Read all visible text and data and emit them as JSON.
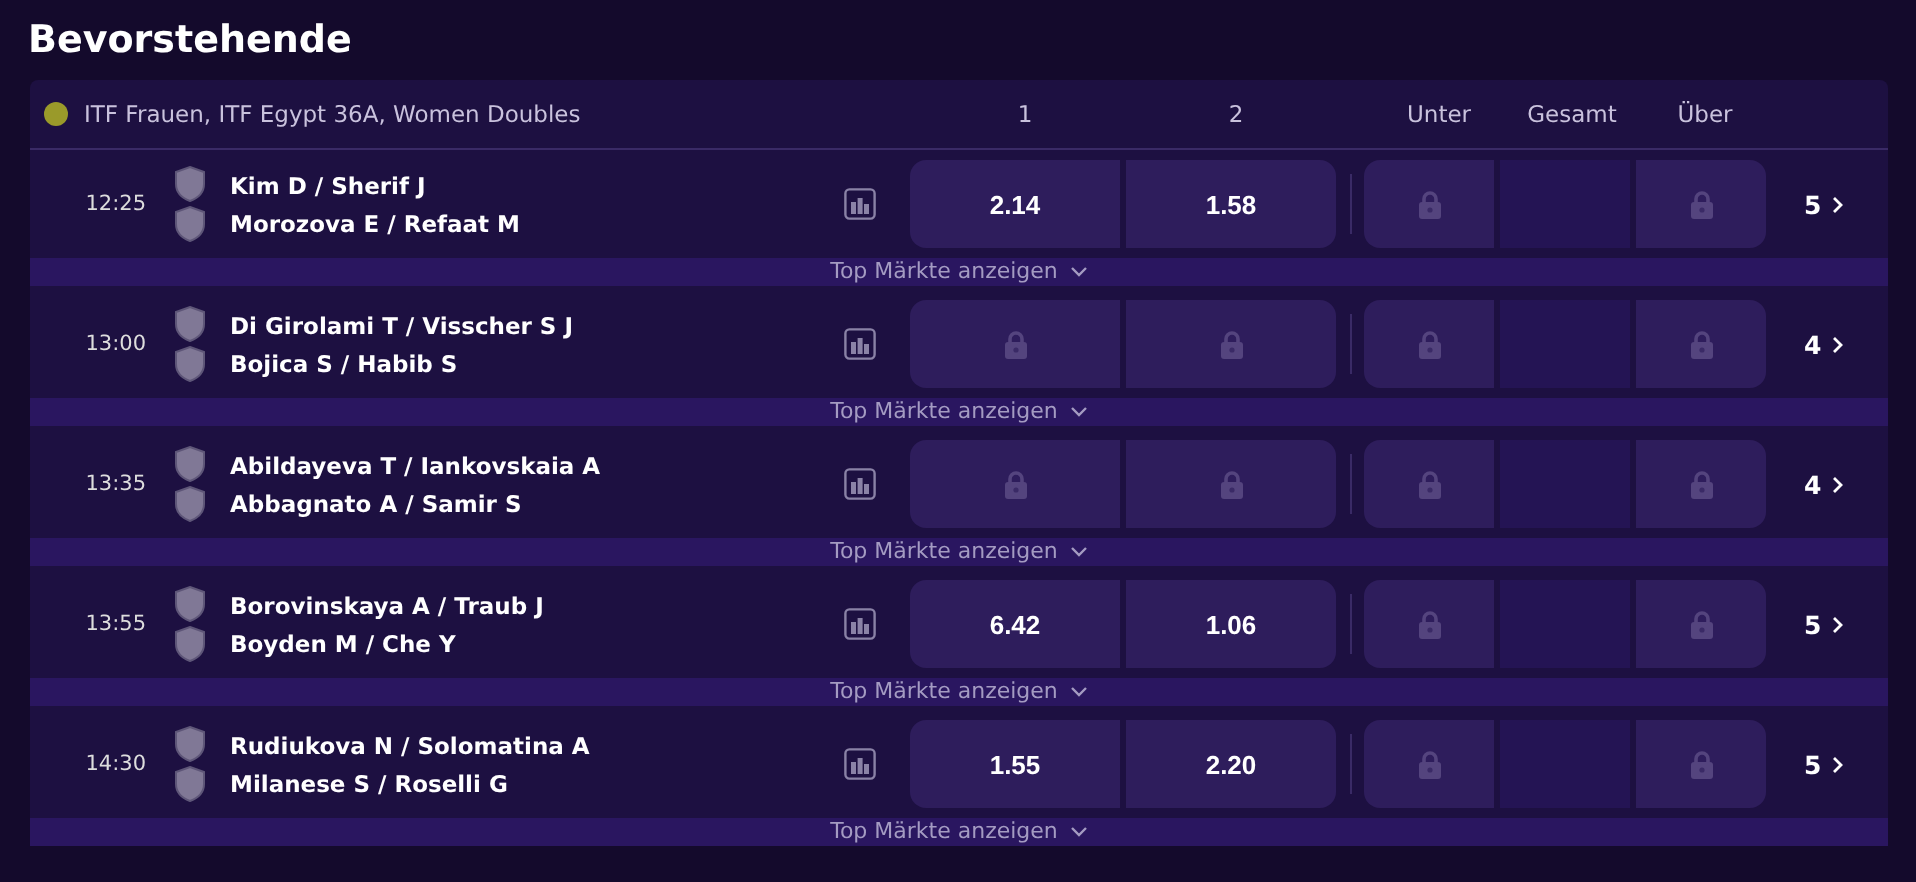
{
  "title": "Bevorstehende",
  "league": {
    "name": "ITF Frauen, ITF Egypt 36A, Women Doubles",
    "columns": [
      "1",
      "2",
      "Unter",
      "Gesamt",
      "Über"
    ]
  },
  "matches": [
    {
      "time": "12:25",
      "team1": "Kim D / Sherif J",
      "team2": "Morozova E / Refaat M",
      "odds": [
        {
          "value": "2.14",
          "locked": false
        },
        {
          "value": "1.58",
          "locked": false
        }
      ],
      "totals": [
        {
          "locked": true
        },
        {
          "locked": false
        },
        {
          "locked": true
        }
      ],
      "more": "5",
      "footer": "Top Märkte anzeigen"
    },
    {
      "time": "13:00",
      "team1": "Di Girolami T / Visscher S J",
      "team2": "Bojica S / Habib S",
      "odds": [
        {
          "locked": true
        },
        {
          "locked": true
        }
      ],
      "totals": [
        {
          "locked": true
        },
        {
          "locked": false
        },
        {
          "locked": true
        }
      ],
      "more": "4",
      "footer": "Top Märkte anzeigen"
    },
    {
      "time": "13:35",
      "team1": "Abildayeva T / Iankovskaia A",
      "team2": "Abbagnato A / Samir S",
      "odds": [
        {
          "locked": true
        },
        {
          "locked": true
        }
      ],
      "totals": [
        {
          "locked": true
        },
        {
          "locked": false
        },
        {
          "locked": true
        }
      ],
      "more": "4",
      "footer": "Top Märkte anzeigen"
    },
    {
      "time": "13:55",
      "team1": "Borovinskaya A / Traub J",
      "team2": "Boyden M / Che Y",
      "odds": [
        {
          "value": "6.42",
          "locked": false
        },
        {
          "value": "1.06",
          "locked": false
        }
      ],
      "totals": [
        {
          "locked": true
        },
        {
          "locked": false
        },
        {
          "locked": true
        }
      ],
      "more": "5",
      "footer": "Top Märkte anzeigen"
    },
    {
      "time": "14:30",
      "team1": "Rudiukova N / Solomatina A",
      "team2": "Milanese S / Roselli G",
      "odds": [
        {
          "value": "1.55",
          "locked": false
        },
        {
          "value": "2.20",
          "locked": false
        }
      ],
      "totals": [
        {
          "locked": true
        },
        {
          "locked": false
        },
        {
          "locked": true
        }
      ],
      "more": "5",
      "footer": "Top Märkte anzeigen"
    }
  ]
}
